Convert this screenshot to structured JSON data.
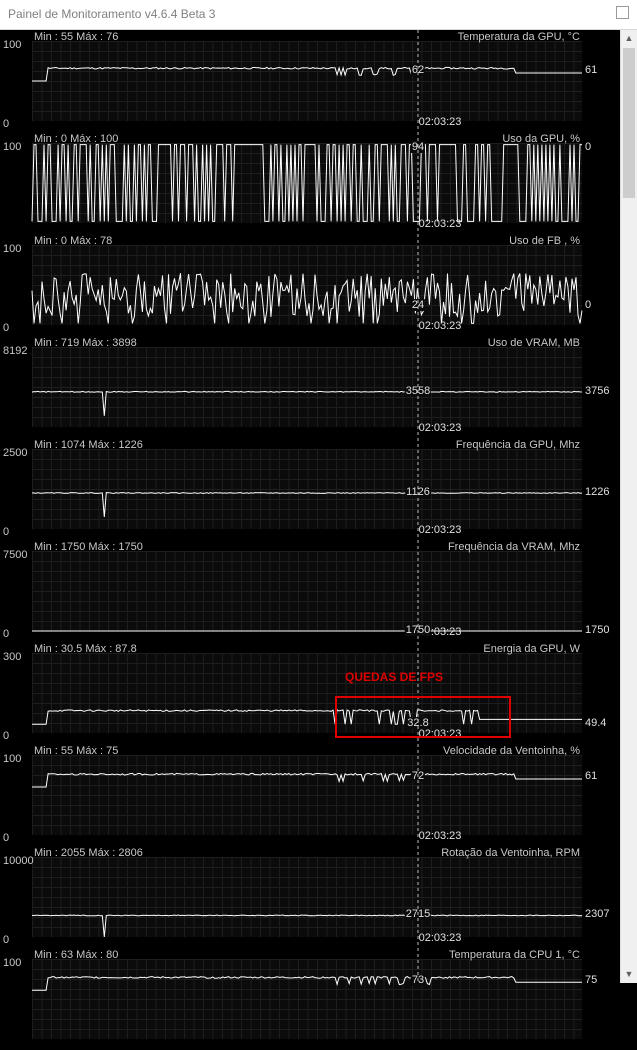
{
  "window": {
    "title": "Painel de Monitoramento v4.6.4 Beta 3"
  },
  "cursor_time": "02:03:23",
  "annotation": {
    "text": "QUEDAS DE FPS",
    "color": "#e00000"
  },
  "colors": {
    "background": "#000000",
    "trace": "#ffffff",
    "grid": "#1e1e1e"
  },
  "panels": [
    {
      "title": "Temperatura da GPU, °C",
      "min_max": "Min : 55   Máx : 76",
      "y_max": "100",
      "y_min": "0",
      "scale": 100,
      "cursor_value": "62",
      "right_value": "61",
      "pattern": "temp",
      "level": 0.62,
      "time": "02:03:23"
    },
    {
      "title": "Uso da GPU, %",
      "min_max": "Min : 0   Máx : 100",
      "y_max": "100",
      "y_min": "",
      "scale": 100,
      "cursor_value": "94",
      "right_value": "0",
      "pattern": "spiky",
      "level": 0.94,
      "time": "02:03:23"
    },
    {
      "title": "Uso de FB , %",
      "min_max": "Min : 0   Máx : 78",
      "y_max": "100",
      "y_min": "0",
      "scale": 100,
      "cursor_value": "24",
      "right_value": "0",
      "pattern": "noise",
      "level": 0.24,
      "time": "02:03:23"
    },
    {
      "title": "Uso de VRAM, MB",
      "min_max": "Min : 719   Máx : 3898",
      "y_max": "8192",
      "y_min": "",
      "scale": 8192,
      "cursor_value": "3558",
      "right_value": "3756",
      "pattern": "flat",
      "level": 0.44,
      "time": "02:03:23"
    },
    {
      "title": "Frequência da GPU, Mhz",
      "min_max": "Min : 1074   Máx : 1226",
      "y_max": "2500",
      "y_min": "0",
      "scale": 2500,
      "cursor_value": "1126",
      "right_value": "1226",
      "pattern": "flat",
      "level": 0.45,
      "time": "02:03:23"
    },
    {
      "title": "Frequência da VRAM, Mhz",
      "min_max": "Min : 1750   Máx : 1750",
      "y_max": "7500",
      "y_min": "0",
      "scale": 7500,
      "cursor_value": "1750",
      "right_value": "1750",
      "pattern": "line",
      "level": 0.0,
      "time": "02:03:23"
    },
    {
      "title": "Energia da GPU, W",
      "min_max": "Min : 30.5   Máx : 87.8",
      "y_max": "300",
      "y_min": "0",
      "scale": 300,
      "cursor_value": "32.8",
      "right_value": "49.4",
      "pattern": "power",
      "level": 0.11,
      "time": "02:03:23"
    },
    {
      "title": "Velocidade da Ventoinha, %",
      "min_max": "Min : 55   Máx : 75",
      "y_max": "100",
      "y_min": "0",
      "scale": 100,
      "cursor_value": "72",
      "right_value": "61",
      "pattern": "temp",
      "level": 0.72,
      "time": "02:03:23"
    },
    {
      "title": "Rotação da Ventoinha, RPM",
      "min_max": "Min : 2055   Máx : 2806",
      "y_max": "10000",
      "y_min": "0",
      "scale": 10000,
      "cursor_value": "2715",
      "right_value": "2307",
      "pattern": "flat",
      "level": 0.27,
      "time": "02:03:23"
    },
    {
      "title": "Temperatura da CPU 1, °C",
      "min_max": "Min : 63   Máx : 80",
      "y_max": "100",
      "y_min": "",
      "scale": 100,
      "cursor_value": "73",
      "right_value": "75",
      "pattern": "temp",
      "level": 0.73,
      "time": ""
    }
  ]
}
